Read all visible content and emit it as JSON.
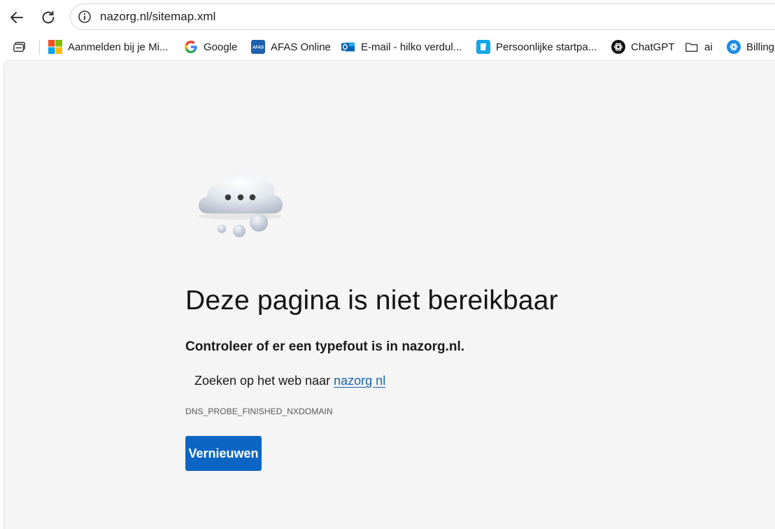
{
  "browser": {
    "url": "nazorg.nl/sitemap.xml",
    "bookmarks": [
      {
        "label": "Aanmelden bij je Mi...",
        "icon": "microsoft-icon"
      },
      {
        "label": "Google",
        "icon": "google-icon"
      },
      {
        "label": "AFAS Online",
        "icon": "afas-icon"
      },
      {
        "label": "E-mail - hilko verdul...",
        "icon": "outlook-icon"
      },
      {
        "label": "Persoonlijke startpa...",
        "icon": "startpage-icon"
      },
      {
        "label": "ChatGPT",
        "icon": "chatgpt-icon"
      },
      {
        "label": "ai",
        "icon": "folder-icon"
      },
      {
        "label": "Billing",
        "icon": "billing-icon"
      }
    ],
    "afas_badge": "AFAS"
  },
  "error": {
    "title": "Deze pagina is niet bereikbaar",
    "subtitle": "Controleer of er een typefout is in nazorg.nl.",
    "suggest_prefix": "Zoeken op het web naar ",
    "suggest_link": "nazorg nl",
    "code": "DNS_PROBE_FINISHED_NXDOMAIN",
    "reload_label": "Vernieuwen"
  },
  "colors": {
    "accent": "#0b66c3",
    "link": "#1564b3",
    "page_bg": "#f5f5f5"
  }
}
